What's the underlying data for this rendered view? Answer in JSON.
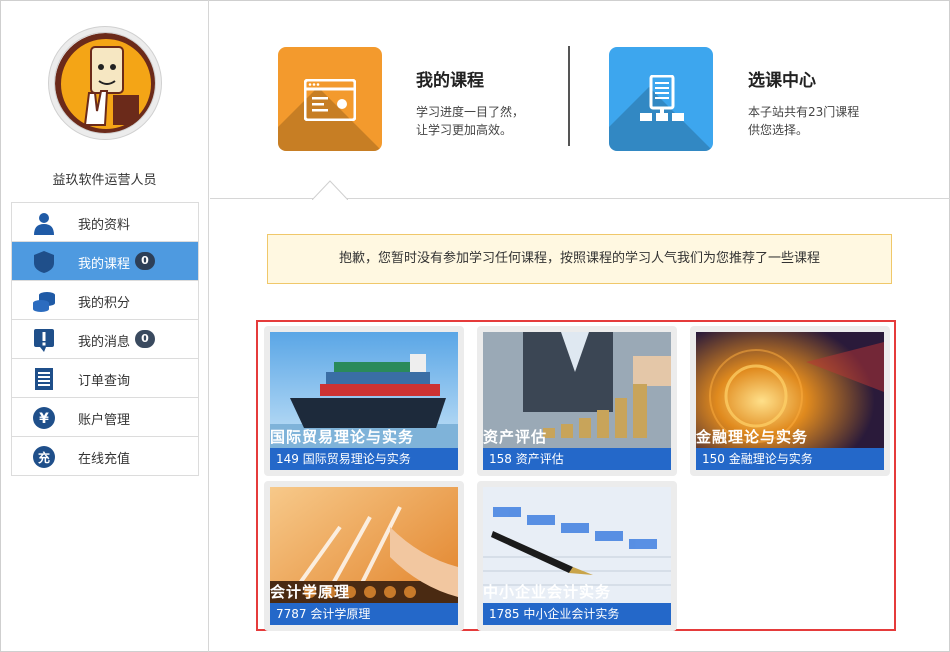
{
  "sidebar": {
    "user_name": "益玖软件运营人员",
    "menu": [
      {
        "label": "我的资料",
        "icon": "user-icon"
      },
      {
        "label": "我的课程",
        "icon": "shield-icon",
        "badge": "0",
        "active": true
      },
      {
        "label": "我的积分",
        "icon": "coins-icon"
      },
      {
        "label": "我的消息",
        "icon": "alert-icon",
        "badge": "0"
      },
      {
        "label": "订单查询",
        "icon": "list-icon"
      },
      {
        "label": "账户管理",
        "icon": "yen-icon"
      },
      {
        "label": "在线充值",
        "icon": "recharge-icon",
        "icon_text": "充"
      }
    ],
    "yen_symbol": "¥"
  },
  "header": {
    "my_courses": {
      "title": "我的课程",
      "desc_line1": "学习进度一目了然，",
      "desc_line2": "让学习更加高效。"
    },
    "course_center": {
      "title": "选课中心",
      "desc_line1": "本子站共有23门课程",
      "desc_line2": "供您选择。"
    }
  },
  "notice": "抱歉，您暂时没有参加学习任何课程，按照课程的学习人气我们为您推荐了一些课程",
  "courses": [
    {
      "overlay": "国际贸易理论与实务",
      "caption": "149 国际贸易理论与实务"
    },
    {
      "overlay": "资产评估",
      "caption": "158 资产评估"
    },
    {
      "overlay": "金融理论与实务",
      "caption": "150 金融理论与实务"
    },
    {
      "overlay": "会计学原理",
      "caption": "7787 会计学原理"
    },
    {
      "overlay": "中小企业会计实务",
      "caption": "1785 中小企业会计实务"
    }
  ],
  "colors": {
    "accent_blue": "#4e9ae0",
    "orange_tile": "#f39a2d",
    "blue_tile": "#3da6ee",
    "highlight_red": "#e53b3b",
    "caption_blue": "#2468c9"
  }
}
